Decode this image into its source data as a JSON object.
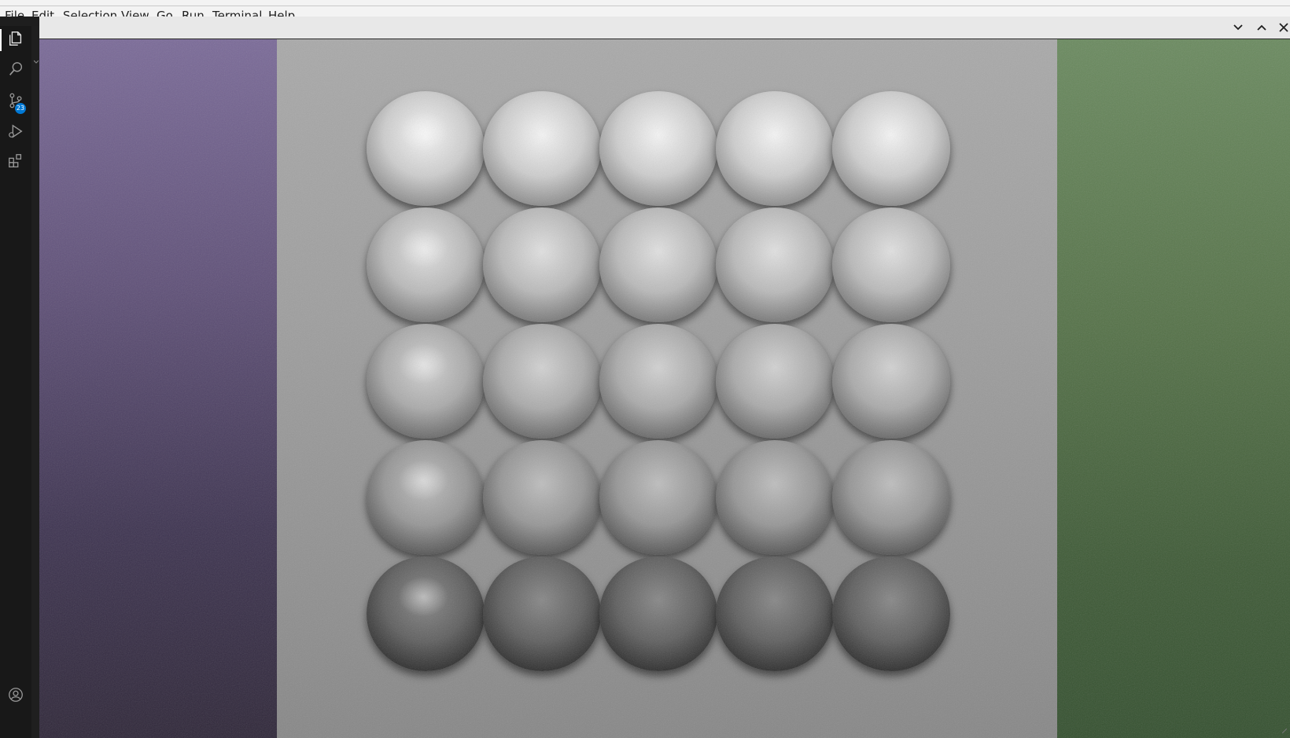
{
  "menu": {
    "items": [
      "File",
      "Edit",
      "Selection",
      "View",
      "Go",
      "Run",
      "Terminal",
      "Help"
    ]
  },
  "activity_bar": {
    "items": [
      {
        "name": "explorer",
        "icon": "files-icon",
        "active": true
      },
      {
        "name": "search",
        "icon": "search-icon"
      },
      {
        "name": "source-control",
        "icon": "source-control-icon",
        "badge": "23"
      },
      {
        "name": "run-and-debug",
        "icon": "run-debug-icon"
      },
      {
        "name": "extensions",
        "icon": "extensions-icon"
      }
    ],
    "bottom_item": {
      "name": "accounts",
      "icon": "account-icon"
    }
  },
  "panel": {
    "controls": [
      "chevron-down-icon",
      "chevron-up-icon",
      "close-icon"
    ]
  },
  "render": {
    "description_colors": {
      "left_wall": "#6a5a88",
      "right_wall": "#5a7a4f",
      "back_wall": "#9c9c9c"
    },
    "grid_rows": 5,
    "grid_cols": 5
  },
  "colors": {
    "badge": "#0078d4",
    "activity_bar_bg": "#181818",
    "menubar_bg": "#f3f3f3"
  }
}
